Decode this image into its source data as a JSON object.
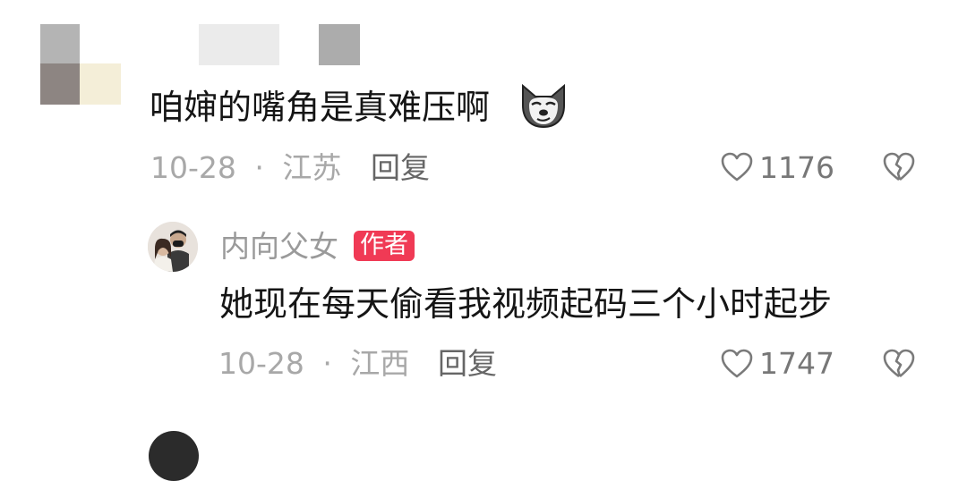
{
  "comments": [
    {
      "text": "咱婶的嘴角是真难压啊",
      "emoji_icon": "doge-emoji-icon",
      "date": "10-28",
      "separator": "·",
      "location": "江苏",
      "reply_label": "回复",
      "likes": "1176"
    }
  ],
  "reply": {
    "username": "内向父女",
    "author_badge": "作者",
    "text": "她现在每天偷看我视频起码三个小时起步",
    "date": "10-28",
    "separator": "·",
    "location": "江西",
    "reply_label": "回复",
    "likes": "1747"
  },
  "colors": {
    "badge": "#f03a55",
    "meta_text": "#a8a8a8",
    "body_text": "#151515"
  }
}
